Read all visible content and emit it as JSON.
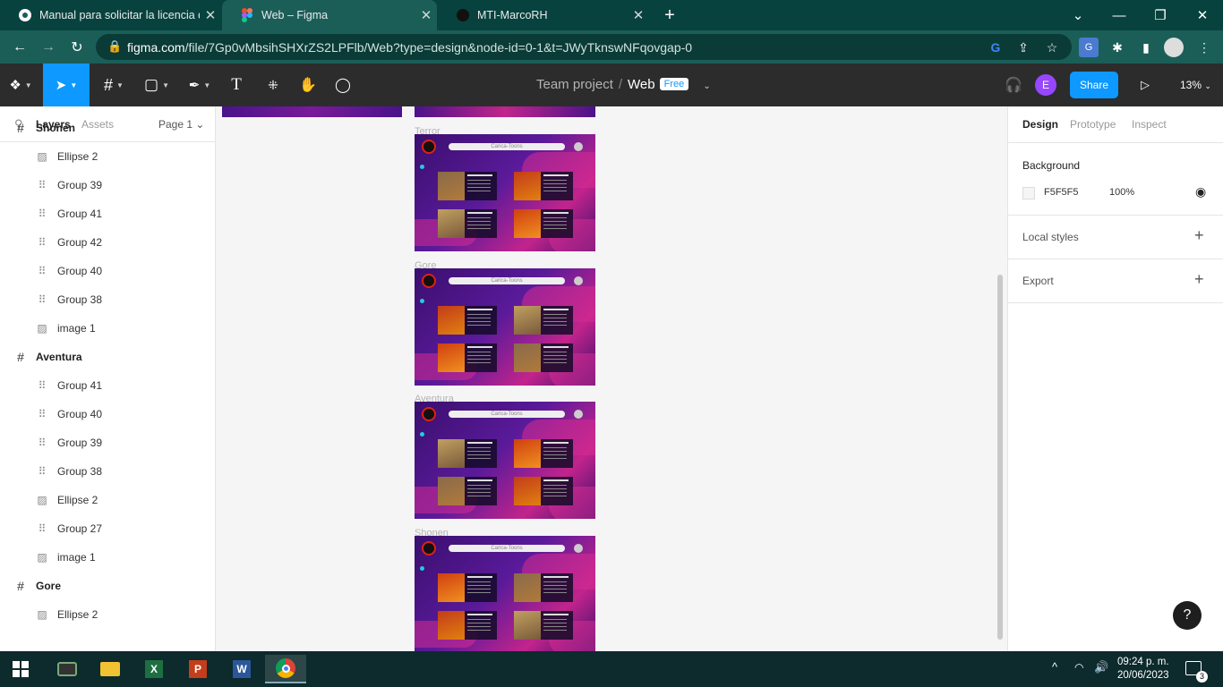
{
  "browser": {
    "tabs": [
      {
        "title": "Manual para solicitar la licencia d",
        "icon": "chrome-page-icon",
        "active": false
      },
      {
        "title": "Web – Figma",
        "icon": "figma-icon",
        "active": true
      },
      {
        "title": "MTI-MarcoRH",
        "icon": "github-icon",
        "active": false
      }
    ],
    "new_tab": "+",
    "url_host": "figma.com",
    "url_path": "/file/7Gp0vMbsihSHXrZS2LPFlb/Web?type=design&node-id=0-1&t=JWyTknswNFqovgap-0",
    "window_buttons": [
      "⌄",
      "—",
      "❐",
      "✕"
    ]
  },
  "figma": {
    "breadcrumb": {
      "team": "Team project",
      "separator": "/",
      "file": "Web",
      "badge": "Free"
    },
    "avatar_initial": "E",
    "share_label": "Share",
    "zoom": "13%",
    "accent": "#0d99ff"
  },
  "left_panel": {
    "tabs": [
      "Layers",
      "Assets"
    ],
    "page": "Page 1 ⌄",
    "layers": [
      {
        "name": "Shonen",
        "type": "frame"
      },
      {
        "name": "Ellipse 2",
        "type": "image"
      },
      {
        "name": "Group 39",
        "type": "group"
      },
      {
        "name": "Group 41",
        "type": "group"
      },
      {
        "name": "Group 42",
        "type": "group"
      },
      {
        "name": "Group 40",
        "type": "group"
      },
      {
        "name": "Group 38",
        "type": "group"
      },
      {
        "name": "image 1",
        "type": "image"
      },
      {
        "name": "Aventura",
        "type": "frame"
      },
      {
        "name": "Group 41",
        "type": "group"
      },
      {
        "name": "Group 40",
        "type": "group"
      },
      {
        "name": "Group 39",
        "type": "group"
      },
      {
        "name": "Group 38",
        "type": "group"
      },
      {
        "name": "Ellipse 2",
        "type": "image"
      },
      {
        "name": "Group 27",
        "type": "group"
      },
      {
        "name": "image 1",
        "type": "image"
      },
      {
        "name": "Gore",
        "type": "frame"
      },
      {
        "name": "Ellipse 2",
        "type": "image"
      }
    ]
  },
  "canvas": {
    "frames": [
      {
        "label": "Terror",
        "search_text": "Carica-Toons",
        "cards": [
          "Jurg de Yainsime",
          "Dark Bitter",
          "The Whittawentanclasm",
          "Dessie Patty"
        ]
      },
      {
        "label": "Gore",
        "search_text": "Carica-Toons",
        "cards": [
          "Blue Unit",
          "Decent",
          "Hellsing",
          "Mobilefulfire"
        ]
      },
      {
        "label": "Aventura",
        "search_text": "Carica-Toons",
        "cards": [
          "Lor of Fairytale Hopefield",
          "Shadows",
          "Fairy Tales",
          "One Piece"
        ]
      },
      {
        "label": "Shonen",
        "search_text": "Carica-Toons",
        "cards": [
          "Bleach",
          "My Destiny",
          "Attack on Titan",
          "Solo"
        ]
      }
    ]
  },
  "right_panel": {
    "tabs": [
      "Design",
      "Prototype",
      "Inspect"
    ],
    "background": {
      "title": "Background",
      "hex": "F5F5F5",
      "opacity": "100%"
    },
    "local_styles": "Local styles",
    "export": "Export"
  },
  "taskbar": {
    "time": "09:24 p. m.",
    "date": "20/06/2023",
    "notifications": "3",
    "apps": [
      "gamebar-icon",
      "file-explorer-icon",
      "excel-icon",
      "powerpoint-icon",
      "word-icon",
      "chrome-icon"
    ]
  },
  "help": "?"
}
